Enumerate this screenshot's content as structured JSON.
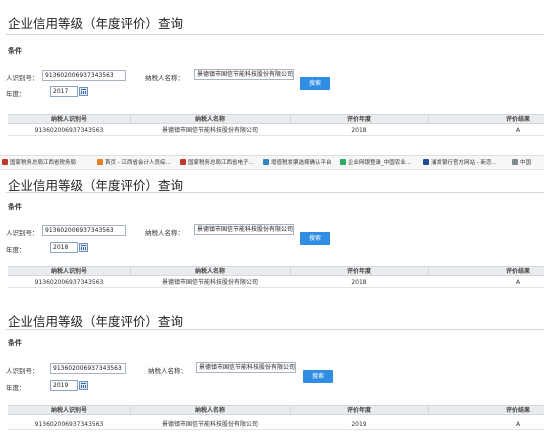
{
  "panels": [
    {
      "title": "企业信用等级（年度评价）查询",
      "condition_label": "条件",
      "taxpayer_id_label": "人识别号：",
      "taxpayer_id_value": "913602006937343563",
      "taxpayer_name_label": "纳税人名称：",
      "taxpayer_name_value": "景德镇市国信节能科技股份有限公司",
      "year_label": "年度：",
      "year_value": "2017",
      "search_label": "搜索",
      "columns": [
        "纳税人识别号",
        "纳税人名称",
        "评价年度",
        "评价结果"
      ],
      "row": [
        "913602006937343563",
        "景德镇市国信节能科技股份有限公司",
        "2018",
        "A"
      ]
    },
    {
      "title": "企业信用等级（年度评价）查询",
      "condition_label": "条件",
      "taxpayer_id_label": "人识别号：",
      "taxpayer_id_value": "913602006937343563",
      "taxpayer_name_label": "纳税人名称：",
      "taxpayer_name_value": "景德镇市国信节能科技股份有限公司",
      "year_label": "年度：",
      "year_value": "2018",
      "search_label": "搜索",
      "columns": [
        "纳税人识别号",
        "纳税人名称",
        "评价年度",
        "评价结果"
      ],
      "row": [
        "913602006937343563",
        "景德镇市国信节能科技股份有限公司",
        "2018",
        "A"
      ]
    },
    {
      "title": "企业信用等级（年度评价）查询",
      "condition_label": "条件",
      "taxpayer_id_label": "人识别号：",
      "taxpayer_id_value": "913602006937343563",
      "taxpayer_name_label": "纳税人名称：",
      "taxpayer_name_value": "景德镇市国信节能科技股份有限公司",
      "year_label": "年度：",
      "year_value": "2019",
      "search_label": "搜索",
      "columns": [
        "纳税人识别号",
        "纳税人名称",
        "评价年度",
        "评价结果"
      ],
      "row": [
        "913602006937343563",
        "景德镇市国信节能科技股份有限公司",
        "2019",
        "A"
      ]
    }
  ],
  "bookmarks": [
    {
      "label": "国家税务总局江西省税务局",
      "color": "#c0392b"
    },
    {
      "label": "首页 - 江西省会计人员综...",
      "color": "#e67e22"
    },
    {
      "label": "国家税务总局江西省电子...",
      "color": "#c0392b"
    },
    {
      "label": "增值税发票选择确认平台",
      "color": "#2e86c1"
    },
    {
      "label": "企业网银登录_中国农业...",
      "color": "#27ae60"
    },
    {
      "label": "浦发银行官方网站 - 新恋...",
      "color": "#1f4e96"
    },
    {
      "label": "中国",
      "color": "#7f8c8d"
    }
  ]
}
